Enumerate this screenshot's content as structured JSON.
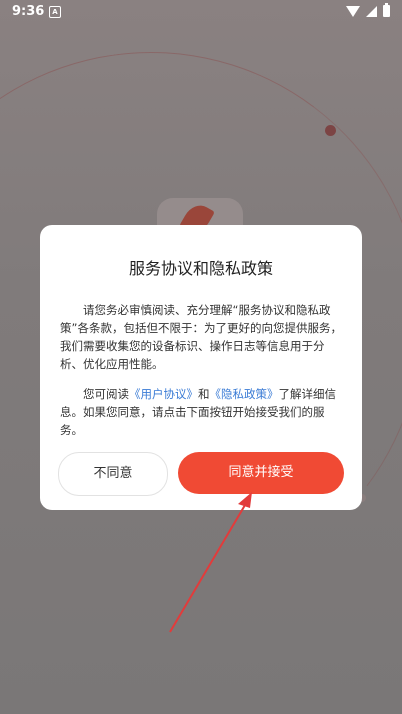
{
  "statusbar": {
    "time": "9:36",
    "a_icon_label": "A"
  },
  "dialog": {
    "title": "服务协议和隐私政策",
    "para1": "请您务必审慎阅读、充分理解“服务协议和隐私政策”各条款，包括但不限于：为了更好的向您提供服务，我们需要收集您的设备标识、操作日志等信息用于分析、优化应用性能。",
    "para2_prefix": "您可阅读",
    "link_user_agreement": "《用户协议》",
    "para2_and": "和",
    "link_privacy_policy": "《隐私政策》",
    "para2_suffix": "了解详细信息。如果您同意，请点击下面按钮开始接受我们的服务。",
    "decline_label": "不同意",
    "accept_label": "同意并接受"
  },
  "colors": {
    "accent": "#f04a34",
    "link": "#3a7bd5",
    "arrow": "#e23b3b"
  },
  "icons": [
    "a-icon",
    "wifi-icon",
    "signal-icon",
    "battery-icon"
  ]
}
